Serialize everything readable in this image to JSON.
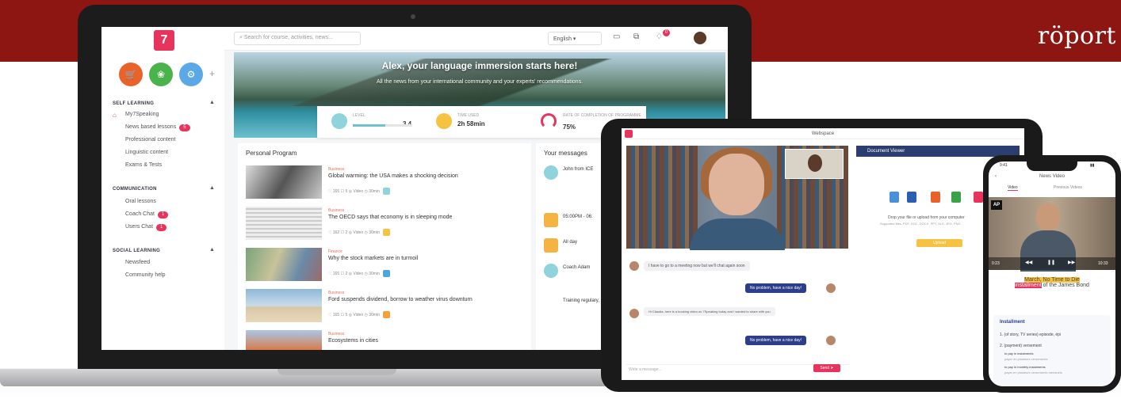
{
  "brand": "röport",
  "laptop": {
    "logo": "7",
    "sidebar": {
      "sections": [
        {
          "title": "SELF LEARNING",
          "items": [
            {
              "label": "My7Speaking"
            },
            {
              "label": "News based lessons",
              "badge": "5"
            },
            {
              "label": "Professional content"
            },
            {
              "label": "Linguistic content"
            },
            {
              "label": "Exams & Tests"
            }
          ]
        },
        {
          "title": "COMMUNICATION",
          "items": [
            {
              "label": "Oral lessons"
            },
            {
              "label": "Coach Chat",
              "badge": "1"
            },
            {
              "label": "Users Chat",
              "badge": "1"
            }
          ]
        },
        {
          "title": "SOCIAL LEARNING",
          "items": [
            {
              "label": "Newsfeed"
            },
            {
              "label": "Community help"
            }
          ]
        }
      ]
    },
    "search_placeholder": "Search for course, activities, news...",
    "language": "English",
    "notification_count": "0",
    "hero": {
      "title": "Alex, your language immersion starts here!",
      "subtitle": "All the news from your international community and your experts' recommendations."
    },
    "stats": [
      {
        "label": "LEVEL",
        "value": "3.4",
        "progress": 0.55
      },
      {
        "label": "TIME USED",
        "value": "2h 58min"
      },
      {
        "label": "RATE OF COMPLETION OF PROGRAMME",
        "value": "75%"
      }
    ],
    "program": {
      "title": "Personal Program",
      "cards": [
        {
          "category": "Business",
          "title": "Global warming: the USA makes a shocking decision",
          "meta": "♡ 165   ☐ 5   ◎ Video   ◷ 30min",
          "color": "#8fd3dc"
        },
        {
          "category": "Business",
          "title": "The OECD says that economy is in sleeping mode",
          "meta": "♡ 162   ☐ 2   ◎ Video   ◷ 30min",
          "color": "#f5c242"
        },
        {
          "category": "Finance",
          "title": "Why the stock markets are in turmoil",
          "meta": "♡ 165   ☐ 2   ◎ Video   ◷ 30min",
          "color": "#4aa8e0"
        },
        {
          "category": "Business",
          "title": "Ford suspends dividend, borrow to weather virus downturn",
          "meta": "♡ 165   ☐ 5   ◎ Video   ◷ 30min",
          "color": "#f5a03a"
        },
        {
          "category": "Business",
          "title": "Ecosystems in cities",
          "meta": "",
          "color": "#8fd3dc"
        }
      ]
    },
    "messages": {
      "title": "Your messages",
      "items": [
        {
          "name": "John from ICE",
          "time": ""
        },
        {
          "name": "",
          "time": "05:00PM - 06:"
        },
        {
          "name": "",
          "time": "All day"
        },
        {
          "name": "Coach Adam",
          "time": ""
        }
      ],
      "footer": "Training regulary, learn by"
    }
  },
  "tablet": {
    "title": "Webspace",
    "chat": [
      {
        "side": "in",
        "text": "I have to go to a meeting now but we'll chat again soon"
      },
      {
        "side": "out",
        "text": "No problem, have a nice day!"
      },
      {
        "side": "in",
        "text": "Hi Claudia, here is a booking video on 7Speaking today and I wanted to share with you"
      },
      {
        "side": "out",
        "text": "No problem, have a nice day!"
      }
    ],
    "input_placeholder": "Write a message...",
    "send_label": "Send ➤",
    "doc_viewer": {
      "title": "Document Viewer",
      "drop_text": "Drop your file or upload from your computer",
      "sub_text": "Supported files: PDF, DOC, DOCX, PPT, XLS, JPG, PNG",
      "upload_label": "Upload"
    }
  },
  "phone": {
    "time": "9:41",
    "header": "News Video",
    "tabs": [
      "Video",
      "Previous Videos"
    ],
    "ap_label": "AP",
    "time_left": "0:23",
    "time_right": "10:33",
    "subtitle_pre": "March, No Time to Die",
    "subtitle_mid": "installment",
    "subtitle_post": "of the James Bond",
    "card": {
      "word": "Installment",
      "line1": "1. (of story, TV series) episode, épi",
      "line2": "2. (payment) versement",
      "ex1": "to pay in instalments",
      "ex1_tr": "payer en plusieurs versements",
      "ex2": "to pay in monthly instalments",
      "ex2_tr": "payer en plusieurs versements mensuels"
    }
  }
}
